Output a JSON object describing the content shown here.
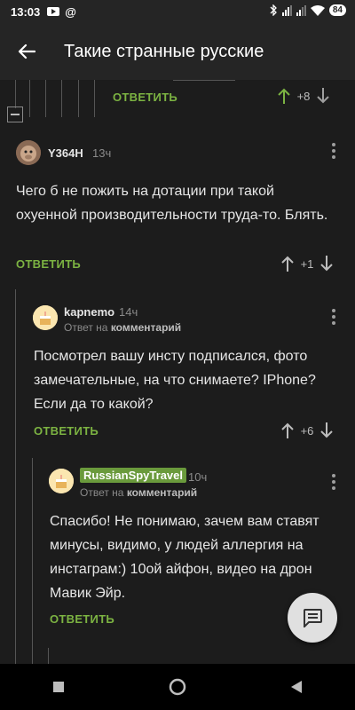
{
  "status": {
    "time": "13:03",
    "at": "@",
    "battery": "84"
  },
  "appbar": {
    "title": "Такие странные русские"
  },
  "top_comment": {
    "reply_label": "ОТВЕТИТЬ",
    "votes": "+8"
  },
  "comment1": {
    "username": "Y364H",
    "time": "13ч",
    "text": "Чего б не пожить на дотации при такой охуенной производительности труда-то. Блять.",
    "reply_label": "ОТВЕТИТЬ",
    "votes": "+1"
  },
  "comment2": {
    "username": "kapnemo",
    "time": "14ч",
    "reply_prefix": "Ответ на",
    "reply_target": "комментарий",
    "text": "Посмотрел вашу инсту подписался, фото замечательные, на что снимаете? IPhone? Если да то какой?",
    "reply_label": "ОТВЕТИТЬ",
    "votes": "+6"
  },
  "comment3": {
    "username": "RussianSpyTravel",
    "time": "10ч",
    "reply_prefix": "Ответ на",
    "reply_target": "комментарий",
    "text": "Спасибо! Не понимаю, зачем вам ставят минусы, видимо, у людей аллергия на инстаграм:) 10ой айфон, видео на дрон Мавик Эйр.",
    "reply_label": "ОТВЕТИТЬ"
  },
  "colors": {
    "accent_green": "#7cb342",
    "badge_green": "#6a9a3c",
    "background": "#1c1c1c"
  }
}
